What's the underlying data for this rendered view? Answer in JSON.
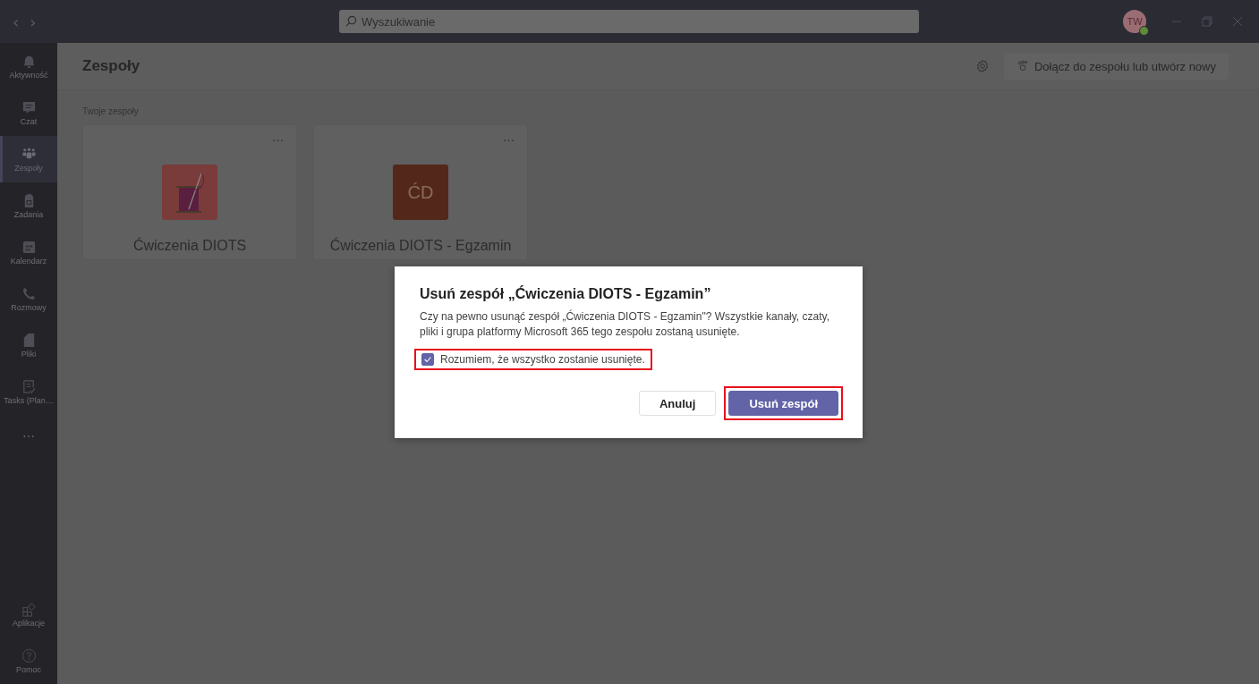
{
  "titlebar": {
    "nav": [
      "‹",
      "›"
    ],
    "search": {
      "placeholder": "Wyszukiwanie"
    },
    "avatar": {
      "initials": "TW"
    }
  },
  "sidebar": {
    "items": [
      {
        "label": "Aktywność",
        "selected": false
      },
      {
        "label": "Czat",
        "selected": false
      },
      {
        "label": "Zespoły",
        "selected": true
      },
      {
        "label": "Zadania",
        "selected": false
      },
      {
        "label": "Kalendarz",
        "selected": false
      },
      {
        "label": "Rozmowy",
        "selected": false
      },
      {
        "label": "Pliki",
        "selected": false
      },
      {
        "label": "Tasks (Plan…",
        "selected": false
      }
    ],
    "more": "…",
    "bottom_items": [
      {
        "label": "Aplikacje",
        "selected": false
      },
      {
        "label": "Pomoc",
        "selected": false
      }
    ]
  },
  "header": {
    "title": "Zespoły",
    "join_button": "Dołącz do zespołu lub utwórz nowy"
  },
  "section_label": "Twoje zespoły",
  "teams": [
    {
      "name": "Ćwiczenia DIOTS",
      "more": "…",
      "logo": {
        "kind": "picture",
        "color": "#7a3b3b"
      }
    },
    {
      "name": "Ćwiczenia DIOTS - Egzamin",
      "more": "…",
      "logo": {
        "kind": "initials",
        "text": "ĆD",
        "color": "#53281a"
      }
    }
  ],
  "dialog": {
    "title": "Usuń zespół „Ćwiczenia DIOTS - Egzamin”",
    "message": "Czy na pewno usunąć zespół „Ćwiczenia DIOTS - Egzamin\"? Wszystkie kanały, czaty, pliki i grupa platformy Microsoft 365 tego zespołu zostaną usunięte.",
    "checkbox": {
      "label": "Rozumiem, że wszystko zostanie usunięte.",
      "checked": true,
      "highlighted": true
    },
    "buttons": [
      {
        "label": "Anuluj",
        "kind": "secondary",
        "highlighted": false
      },
      {
        "label": "Usuń zespół",
        "kind": "primary",
        "highlighted": true
      }
    ]
  }
}
